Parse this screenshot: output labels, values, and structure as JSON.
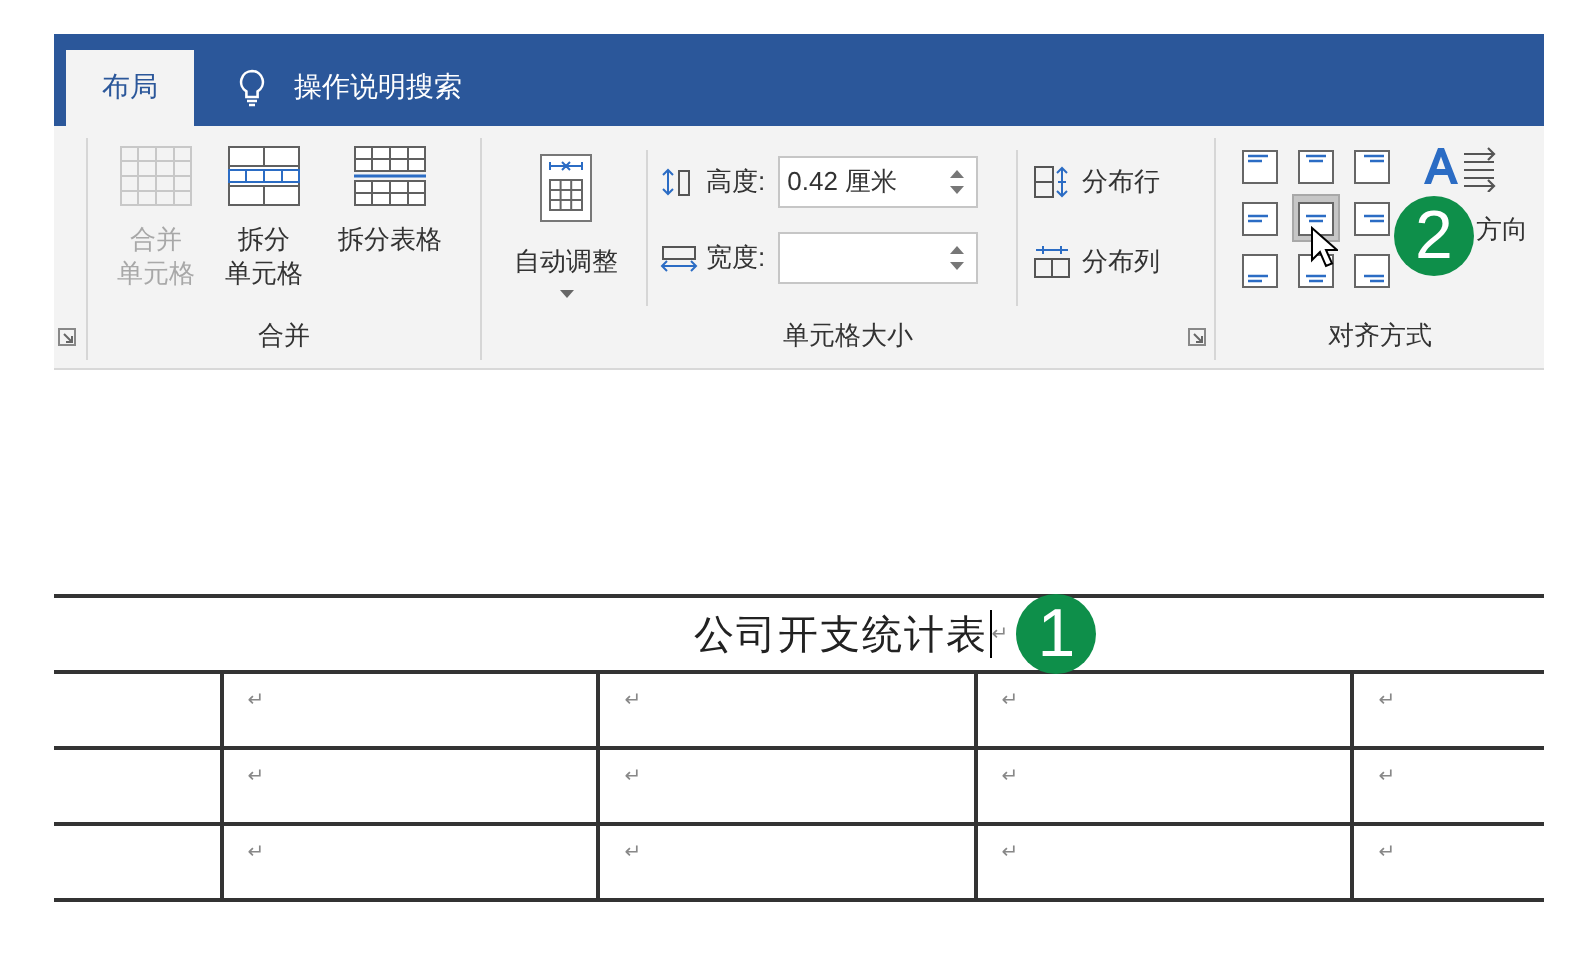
{
  "ribbon_tabs": [
    {
      "label": "布局",
      "selected": true
    }
  ],
  "tell_me": {
    "label": "操作说明搜索"
  },
  "merge_group": {
    "title": "合并",
    "buttons": [
      {
        "kind": "merge",
        "lines": [
          "合并",
          "单元格"
        ],
        "disabled": true
      },
      {
        "kind": "split-cells",
        "lines": [
          "拆分",
          "单元格"
        ],
        "disabled": false
      },
      {
        "kind": "split-table",
        "lines": [
          "拆分表格"
        ],
        "disabled": false
      }
    ]
  },
  "size_group": {
    "title": "单元格大小",
    "autofit": {
      "label": "自动调整"
    },
    "height": {
      "label": "高度:",
      "value": "0.42 厘米"
    },
    "width": {
      "label": "宽度:"
    },
    "distribute": [
      {
        "kind": "rows",
        "label": "分布行"
      },
      {
        "kind": "cols",
        "label": "分布列"
      }
    ]
  },
  "align_group": {
    "title": "对齐方式",
    "callout": "2",
    "text_direction": {
      "label": "方向"
    },
    "cells": [
      {
        "selected": false
      },
      {
        "selected": false
      },
      {
        "selected": false
      },
      {
        "selected": false
      },
      {
        "selected": true
      },
      {
        "selected": false
      },
      {
        "selected": false
      },
      {
        "selected": false
      },
      {
        "selected": false
      }
    ]
  },
  "table": {
    "title": "公司开支统计表",
    "title_mark": "↵",
    "callout": "1",
    "rows": [
      [
        "↵",
        "↵",
        "↵",
        "↵"
      ],
      [
        "↵",
        "↵",
        "↵",
        "↵"
      ],
      [
        "↵",
        "↵",
        "↵",
        "↵"
      ]
    ]
  }
}
